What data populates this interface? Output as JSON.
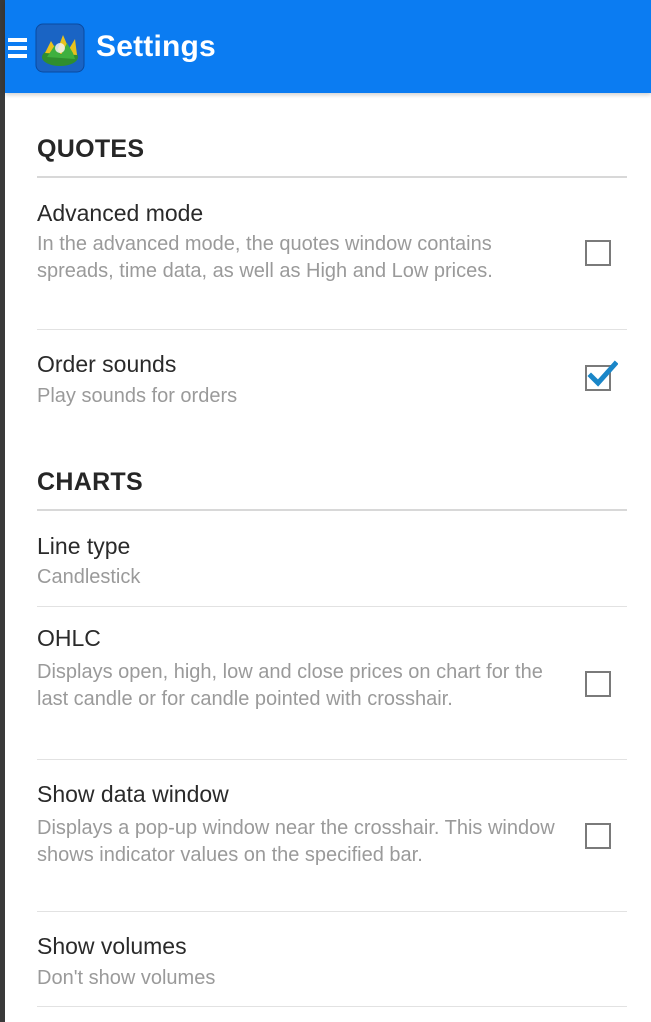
{
  "action_bar": {
    "title": "Settings",
    "background": "#0b7cf2",
    "menu_icon": "hamburger-menu-icon",
    "app_icon": "metatrader-app-icon"
  },
  "sections": [
    {
      "header": "QUOTES",
      "items": [
        {
          "title": "Advanced mode",
          "summary": "In the advanced mode, the quotes window contains spreads, time data, as well as High and Low prices.",
          "has_checkbox": true,
          "checked": false
        },
        {
          "title": "Order sounds",
          "summary": "Play sounds for orders",
          "has_checkbox": true,
          "checked": true
        }
      ]
    },
    {
      "header": "CHARTS",
      "items": [
        {
          "title": "Line type",
          "summary": "Candlestick",
          "has_checkbox": false
        },
        {
          "title": "OHLC",
          "summary": "Displays open, high, low and close prices on chart for the last candle or for candle pointed with crosshair.",
          "has_checkbox": true,
          "checked": false
        },
        {
          "title": "Show data window",
          "summary": "Displays a pop-up window near the crosshair. This window shows indicator values on the specified bar.",
          "has_checkbox": true,
          "checked": false
        },
        {
          "title": "Show volumes",
          "summary": "Don't show volumes",
          "has_checkbox": false
        }
      ]
    }
  ],
  "colors": {
    "accent": "#0b7cf2",
    "check_mark": "#1a86c8",
    "summary_text": "#9a9a9a",
    "title_text": "#2a2a2a"
  }
}
